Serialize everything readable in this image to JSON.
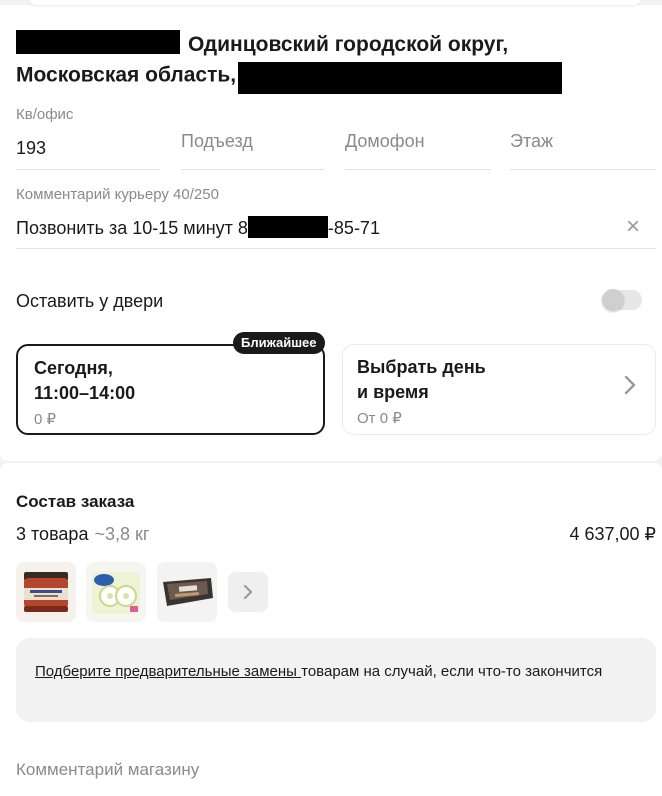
{
  "address": {
    "line_text_1": "Одинцовский городской округ,",
    "line_text_2": "Московская область,"
  },
  "fields": {
    "apartment": {
      "label": "Кв/офис",
      "value": "193"
    },
    "entrance": {
      "placeholder": "Подъезд"
    },
    "intercom": {
      "placeholder": "Домофон"
    },
    "floor": {
      "placeholder": "Этаж"
    },
    "courier_comment": {
      "label": "Комментарий курьеру 40/250",
      "value_prefix": "Позвонить за 10-15 минут 8",
      "value_suffix": "-85-71"
    }
  },
  "leave_at_door": {
    "label": "Оставить у двери",
    "enabled": false
  },
  "delivery_slots": {
    "nearest_badge": "Ближайшее",
    "today": {
      "line1": "Сегодня,",
      "line2": "11:00–14:00",
      "price": "0 ₽",
      "selected": true
    },
    "choose": {
      "line1": "Выбрать день",
      "line2": "и время",
      "price": "От 0 ₽"
    }
  },
  "order": {
    "title": "Состав заказа",
    "count": "3 товара",
    "weight": "~3,8 кг",
    "total": "4 637,00 ₽",
    "thumbnails": [
      "caviar-jar",
      "zewa-toilet-paper",
      "ice-cream-tub"
    ]
  },
  "substitutions": {
    "link_text": "Подберите предварительные замены ",
    "rest_text": "товарам на случай, если что-то закончится"
  },
  "store_comment": {
    "placeholder": "Комментарий магазину"
  },
  "colors": {
    "text": "#1a1a1a",
    "muted": "#8a8a8a",
    "background_gray": "#f2f2f2",
    "badge_bg": "#1a1a1a"
  }
}
